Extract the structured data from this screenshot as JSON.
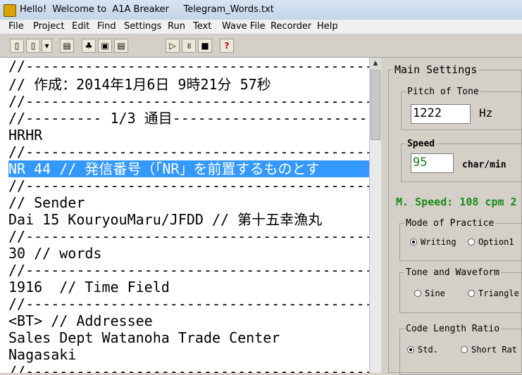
{
  "window": {
    "title": "Hello!  Welcome to  A1A Breaker     Telegram_Words.txt"
  },
  "menu": [
    "File",
    "Project",
    "Edit",
    "Find",
    "Settings",
    "Run",
    "Text",
    "Wave File",
    "Recorder",
    "Help"
  ],
  "editor": {
    "lines": [
      "//--------------------------------------------",
      "// 作成：2014年1月6日 9時21分 57秒",
      "//--------------------------------------------",
      "//--------- 1/3 通目-------------------------",
      "HRHR",
      "//--------------------------------------------",
      "NR 44 // 発信番号（「NR」を前置するものとす",
      "//--------------------------------------------",
      "// Sender",
      "Dai 15 KouryouMaru/JFDD // 第十五幸漁丸",
      "//--------------------------------------------",
      "30 // words",
      "//--------------------------------------------",
      "1916  // Time Field",
      "//--------------------------------------------",
      "<BT> // Addressee",
      "Sales Dept Watanoha Trade Center",
      "Nagasaki",
      "//--------------------------------------------"
    ],
    "selected_line_index": 6
  },
  "panel": {
    "main_settings_label": "Main Settings",
    "pitch": {
      "label": "Pitch of Tone",
      "value": "1222",
      "unit": "Hz"
    },
    "speed": {
      "label": "Speed",
      "value": "95",
      "unit": "char/min"
    },
    "m_speed": "M. Speed: 108 cpm  2",
    "mode": {
      "label": "Mode of Practice",
      "options": [
        "Writing",
        "Option1"
      ],
      "selected": "Writing"
    },
    "tone": {
      "label": "Tone and Waveform",
      "options": [
        "Sine",
        "Triangle"
      ],
      "selected": ""
    },
    "code_length": {
      "label": "Code Length Ratio",
      "options": [
        "Std.",
        "Short Rat"
      ],
      "selected": "Std."
    }
  },
  "colors": {
    "selection": "#3399ff",
    "m_speed": "#1a8a1a"
  }
}
